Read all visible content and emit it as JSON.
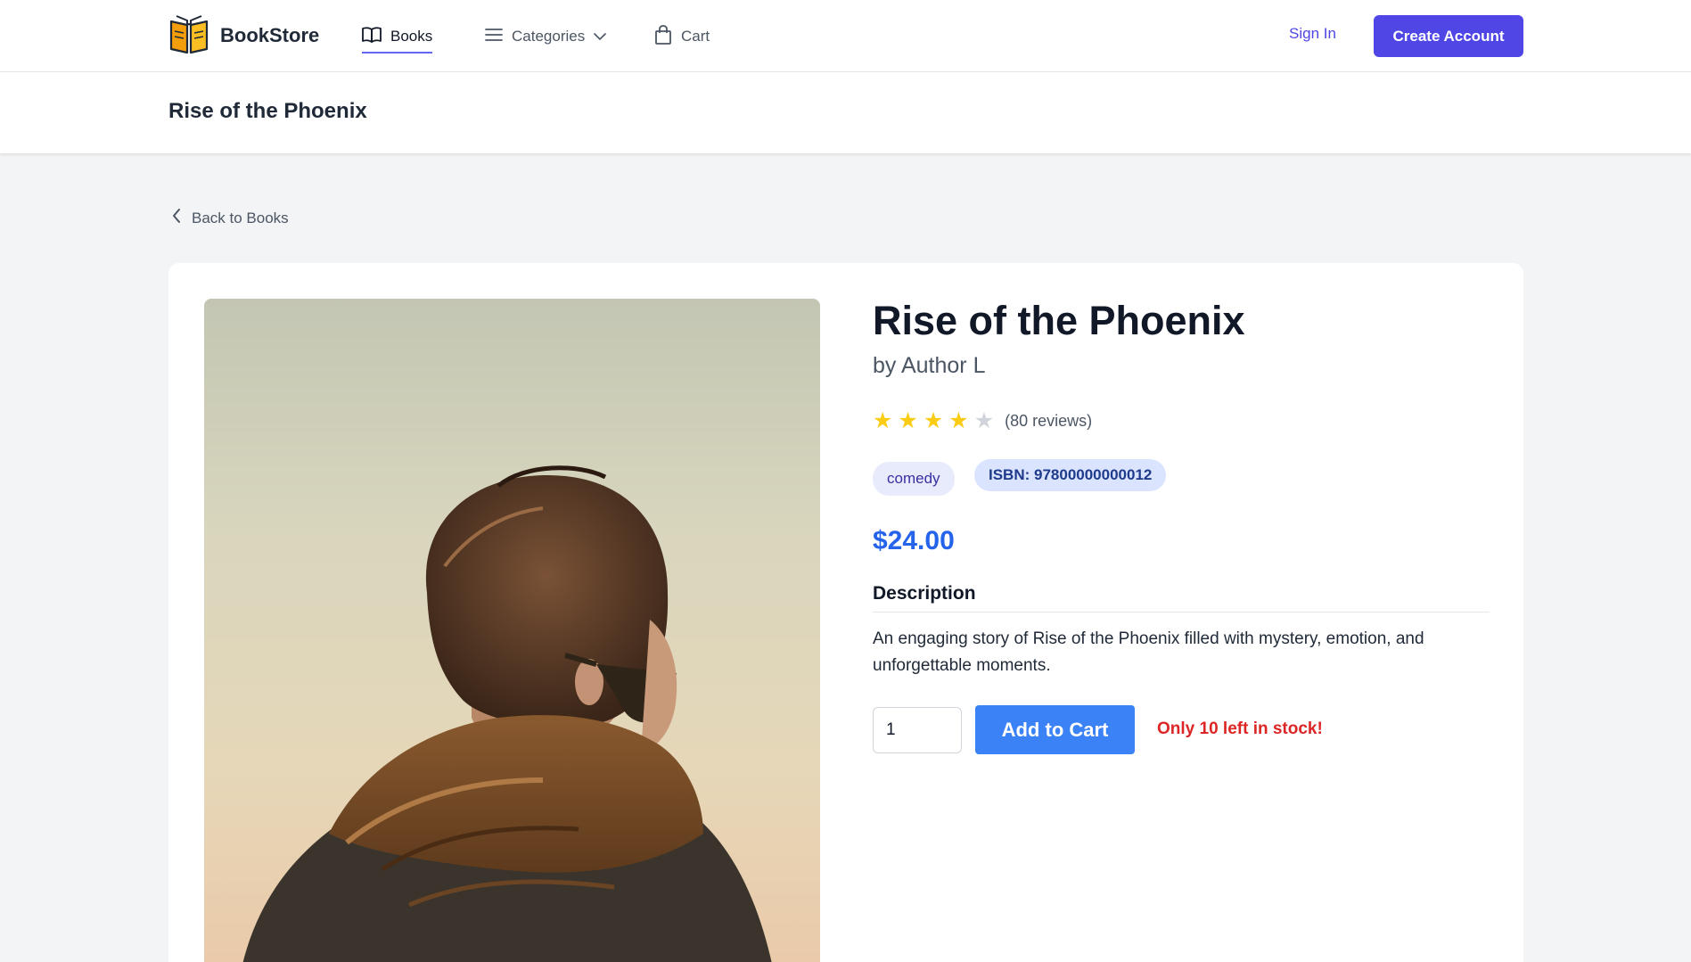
{
  "brand": {
    "name": "BookStore"
  },
  "nav": {
    "books": "Books",
    "categories": "Categories",
    "cart": "Cart"
  },
  "auth": {
    "sign_in": "Sign In",
    "create_account": "Create Account"
  },
  "page_header": {
    "title": "Rise of the Phoenix"
  },
  "back_link": "Back to Books",
  "book": {
    "title": "Rise of the Phoenix",
    "author": "by Author L",
    "rating": 4,
    "rating_max": 5,
    "reviews": "(80 reviews)",
    "genre": "comedy",
    "isbn": "ISBN: 97800000000012",
    "price": "$24.00",
    "description_heading": "Description",
    "description": "An engaging story of Rise of the Phoenix filled with mystery, emotion, and unforgettable moments.",
    "quantity": "1",
    "add_to_cart": "Add to Cart",
    "stock_note": "Only 10 left in stock!"
  },
  "colors": {
    "accent": "#4f46e5",
    "price": "#2563eb",
    "cart_button": "#3b82f6",
    "stock_warning": "#dc2626",
    "star": "#facc15"
  },
  "icons": {
    "brand": "open-book-logo-icon",
    "books": "book-icon",
    "categories": "menu-lines-icon",
    "categories_dropdown": "chevron-down-icon",
    "cart": "shopping-bag-icon",
    "back": "chevron-left-icon",
    "star": "star-icon"
  }
}
